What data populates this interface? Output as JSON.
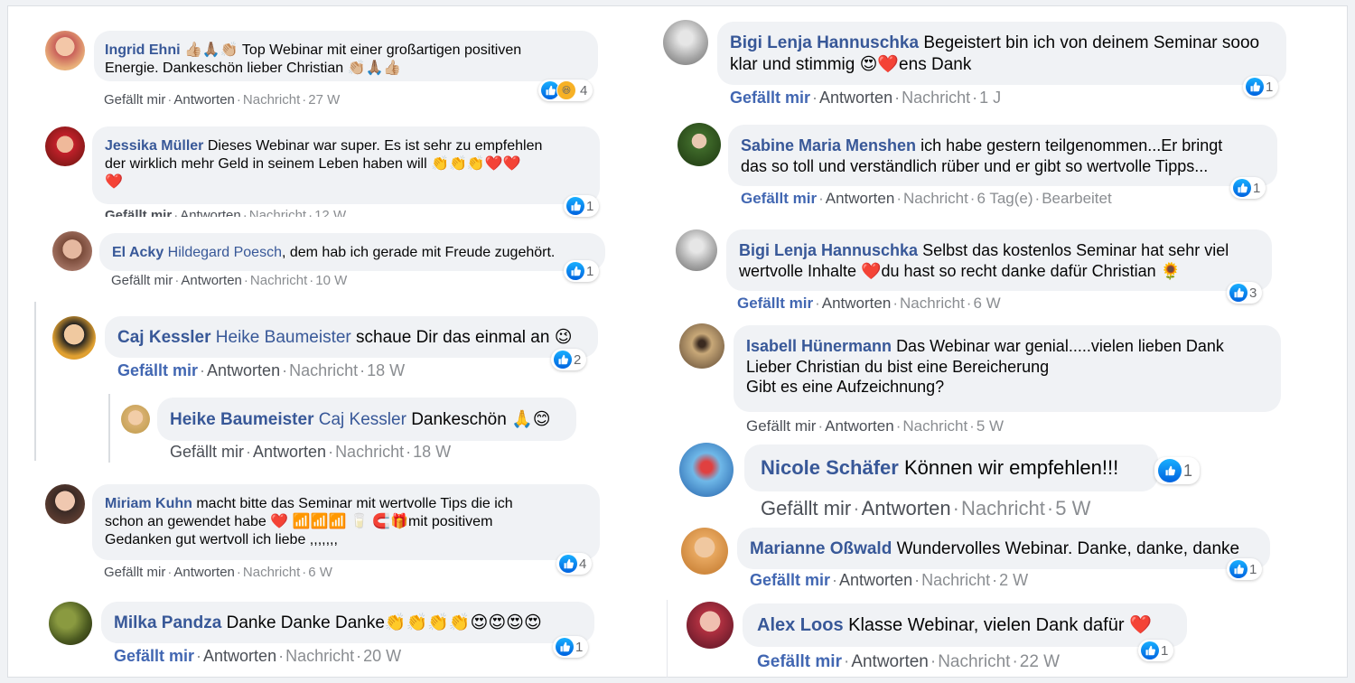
{
  "colors": {
    "link": "#385898",
    "bubble": "#f0f2f5",
    "like": "#1877f2",
    "heart": "#f02849"
  },
  "actions": {
    "like": "Gefällt mir",
    "reply": "Antworten",
    "message": "Nachricht",
    "edited": "Bearbeitet"
  },
  "left": [
    {
      "author": "Ingrid Ehni",
      "tag": "",
      "text_1": "👍🏼🙏🏽👏🏼 Top Webinar mit einer großartigen positiven",
      "text_2": "Energie. Dankeschön lieber Christian 👏🏼🙏🏽👍🏼",
      "time": "27 W",
      "reactions": "4",
      "reaction_icons": [
        "like-icon",
        "haha-icon"
      ]
    },
    {
      "author": "Jessika Müller",
      "tag": "",
      "text_1": "Dieses Webinar war super. Es ist sehr zu empfehlen",
      "text_2": "der wirklich mehr Geld in seinem Leben haben will 👏👏👏❤️❤️",
      "text_3": "❤️",
      "time": "12 W",
      "reactions": "1"
    },
    {
      "author": "El Acky",
      "tag": "Hildegard Poesch",
      "text_1": ", dem hab ich gerade mit Freude zugehört.",
      "time": "10 W",
      "reactions": "1"
    },
    {
      "author": "Caj Kessler",
      "tag": "Heike Baumeister",
      "text_1": "schaue Dir das einmal an 😉",
      "time": "18 W",
      "reactions": "2"
    },
    {
      "author": "Heike Baumeister",
      "tag": "Caj Kessler",
      "text_1": "Dankeschön 🙏😊",
      "time": "18 W",
      "reactions": ""
    },
    {
      "author": "Miriam Kuhn",
      "tag": "",
      "text_1": "macht bitte das Seminar mit wertvolle Tips die ich",
      "text_2": "schon an gewendet habe ❤️ 📶📶📶 🥛 🧲🎁mit positivem",
      "text_3": "Gedanken gut wertvoll ich liebe ,,,,,,,",
      "time": "6 W",
      "reactions": "4"
    },
    {
      "author": "Milka Pandza",
      "tag": "",
      "text_1": "Danke Danke Danke👏👏👏👏😍😍😍😍",
      "time": "20 W",
      "reactions": "1"
    }
  ],
  "right": [
    {
      "author": "Bigi Lenja Hannuschka",
      "tag": "",
      "text_1": "Begeistert bin ich von deinem Seminar sooo",
      "text_2": "klar und stimmig 😍❤️ens Dank",
      "time": "1 J",
      "reactions": "1"
    },
    {
      "author": "Sabine Maria Menshen",
      "tag": "",
      "text_1": "ich habe gestern teilgenommen...Er bringt",
      "text_2": "das so toll und verständlich rüber und er gibt so wertvolle Tipps...",
      "time": "6 Tag(e)",
      "reactions": "1"
    },
    {
      "author": "Bigi Lenja Hannuschka",
      "tag": "",
      "text_1": "Selbst das kostenlos Seminar hat sehr viel",
      "text_2": "wertvolle Inhalte ❤️du hast so recht danke dafür Christian 🌻",
      "time": "6 W",
      "reactions": "3"
    },
    {
      "author": "Isabell Hünermann",
      "tag": "",
      "text_1": "Das Webinar war genial.....vielen lieben Dank",
      "text_2": "Lieber Christian du bist eine Bereicherung",
      "text_3": "Gibt es eine Aufzeichnung?",
      "time": "5 W",
      "reactions": ""
    },
    {
      "author": "Nicole Schäfer",
      "tag": "",
      "text_1": "Können wir empfehlen!!!",
      "time": "5 W",
      "reactions": "1"
    },
    {
      "author": "Marianne Oßwald",
      "tag": "",
      "text_1": "Wundervolles Webinar. Danke, danke, danke",
      "time": "2 W",
      "reactions": "1"
    },
    {
      "author": "Alex Loos",
      "tag": "",
      "text_1": "Klasse Webinar, vielen Dank dafür ❤️",
      "time": "22 W",
      "reactions": "1"
    }
  ]
}
